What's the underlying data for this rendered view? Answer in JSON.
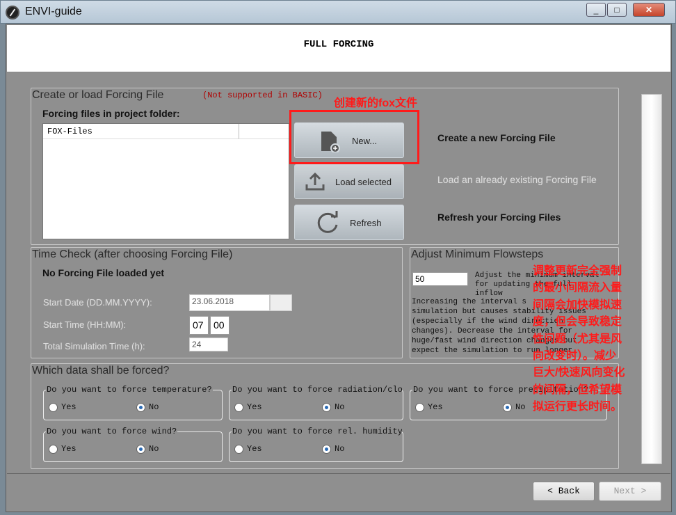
{
  "window": {
    "title": "ENVI-guide",
    "minimize": "_",
    "maximize": "□",
    "close": "✕"
  },
  "header": {
    "title": "FULL FORCING"
  },
  "forcing_panel": {
    "title": "Create or load Forcing File",
    "note": "(Not supported in BASIC)",
    "files_label": "Forcing files in project folder:",
    "list_header": "FOX-Files",
    "buttons": {
      "new": "New...",
      "load": "Load selected",
      "refresh": "Refresh"
    },
    "descriptions": {
      "new": "Create a new Forcing File",
      "load": "Load an already existing Forcing File",
      "refresh": "Refresh your Forcing Files"
    }
  },
  "time_check": {
    "title": "Time Check (after choosing Forcing File)",
    "status": "No Forcing File loaded yet",
    "start_date_label": "Start Date (DD.MM.YYYY):",
    "start_date_value": "23.06.2018",
    "start_time_label": "Start Time (HH:MM):",
    "start_hour": "07",
    "start_minute": "00",
    "total_time_label": "Total Simulation Time (h):",
    "total_time_value": "24"
  },
  "flowsteps": {
    "title": "Adjust Minimum Flowsteps",
    "value": "50",
    "hint_line1": "Adjust the minimum interval",
    "hint_line2": "for updating the full",
    "hint_line3": "inflow",
    "desc_lines": [
      "Increasing the interval s",
      "simulation but causes stability issues",
      "(especially if the wind direction",
      "changes). Decrease the interval for",
      "huge/fast wind direction changes but",
      "expect the simulation to run longer."
    ]
  },
  "forced_data": {
    "title": "Which data shall be forced?",
    "yes": "Yes",
    "no": "No",
    "groups": [
      {
        "question": "Do you want to force temperature?",
        "selected": "No"
      },
      {
        "question": "Do you want to force radiation/clou",
        "selected": "No"
      },
      {
        "question": "Do you want to force precipitation?",
        "selected": "No"
      },
      {
        "question": "Do you want to force wind?",
        "selected": "No"
      },
      {
        "question": "Do you want to force rel. humidity?",
        "selected": "No"
      }
    ]
  },
  "footer": {
    "back": "< Back",
    "next": "Next >"
  },
  "annotations": {
    "new_file": "创建新的fox文件",
    "flowsteps_lines": [
      "调整更新完全强制",
      "的最小间隔流入量",
      "间隔会加快模拟速",
      "度，但会导致稳定",
      "性问题（尤其是风",
      "向改变时）。减少",
      "巨大/快速风向变化",
      "的间隔，但希望模",
      "拟运行更长时间。"
    ]
  }
}
